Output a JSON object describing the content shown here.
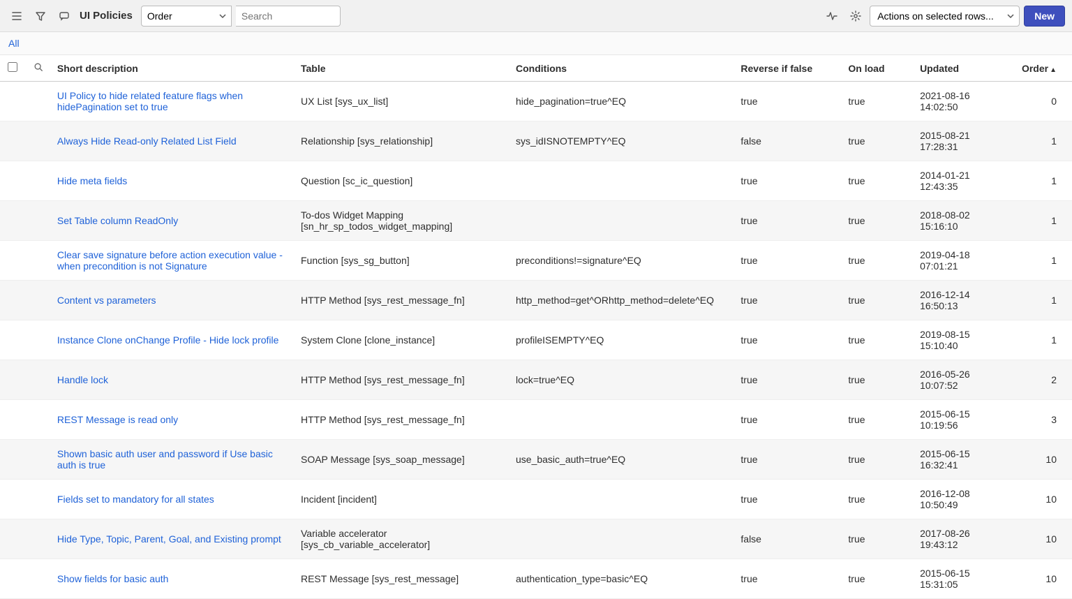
{
  "toolbar": {
    "title": "UI Policies",
    "search_field_selected": "Order",
    "search_placeholder": "Search",
    "actions_placeholder": "Actions on selected rows...",
    "new_label": "New"
  },
  "breadcrumb": {
    "all": "All"
  },
  "columns": {
    "short_description": "Short description",
    "table": "Table",
    "conditions": "Conditions",
    "reverse_if_false": "Reverse if false",
    "on_load": "On load",
    "updated": "Updated",
    "order": "Order"
  },
  "rows": [
    {
      "desc": "UI Policy to hide related feature flags when hidePagination set to true",
      "table": "UX List [sys_ux_list]",
      "cond": "hide_pagination=true^EQ",
      "rev": "true",
      "onload": "true",
      "updated": "2021-08-16 14:02:50",
      "order": "0"
    },
    {
      "desc": "Always Hide Read-only Related List Field",
      "table": "Relationship [sys_relationship]",
      "cond": "sys_idISNOTEMPTY^EQ",
      "rev": "false",
      "onload": "true",
      "updated": "2015-08-21 17:28:31",
      "order": "1"
    },
    {
      "desc": "Hide meta fields",
      "table": "Question [sc_ic_question]",
      "cond": "",
      "rev": "true",
      "onload": "true",
      "updated": "2014-01-21 12:43:35",
      "order": "1"
    },
    {
      "desc": "Set Table column ReadOnly",
      "table": "To-dos Widget Mapping [sn_hr_sp_todos_widget_mapping]",
      "cond": "",
      "rev": "true",
      "onload": "true",
      "updated": "2018-08-02 15:16:10",
      "order": "1"
    },
    {
      "desc": "Clear save signature before action execution value - when precondition is not Signature",
      "table": "Function [sys_sg_button]",
      "cond": "preconditions!=signature^EQ",
      "rev": "true",
      "onload": "true",
      "updated": "2019-04-18 07:01:21",
      "order": "1"
    },
    {
      "desc": "Content vs parameters",
      "table": "HTTP Method [sys_rest_message_fn]",
      "cond": "http_method=get^ORhttp_method=delete^EQ",
      "rev": "true",
      "onload": "true",
      "updated": "2016-12-14 16:50:13",
      "order": "1"
    },
    {
      "desc": "Instance Clone onChange Profile - Hide lock profile",
      "table": "System Clone [clone_instance]",
      "cond": "profileISEMPTY^EQ",
      "rev": "true",
      "onload": "true",
      "updated": "2019-08-15 15:10:40",
      "order": "1"
    },
    {
      "desc": "Handle lock",
      "table": "HTTP Method [sys_rest_message_fn]",
      "cond": "lock=true^EQ",
      "rev": "true",
      "onload": "true",
      "updated": "2016-05-26 10:07:52",
      "order": "2"
    },
    {
      "desc": "REST Message is read only",
      "table": "HTTP Method [sys_rest_message_fn]",
      "cond": "",
      "rev": "true",
      "onload": "true",
      "updated": "2015-06-15 10:19:56",
      "order": "3"
    },
    {
      "desc": "Shown basic auth user and password if Use basic auth is true",
      "table": "SOAP Message [sys_soap_message]",
      "cond": "use_basic_auth=true^EQ",
      "rev": "true",
      "onload": "true",
      "updated": "2015-06-15 16:32:41",
      "order": "10"
    },
    {
      "desc": "Fields set to mandatory for all states",
      "table": "Incident [incident]",
      "cond": "",
      "rev": "true",
      "onload": "true",
      "updated": "2016-12-08 10:50:49",
      "order": "10"
    },
    {
      "desc": "Hide Type, Topic, Parent, Goal, and Existing prompt",
      "table": "Variable accelerator [sys_cb_variable_accelerator]",
      "cond": "",
      "rev": "false",
      "onload": "true",
      "updated": "2017-08-26 19:43:12",
      "order": "10"
    },
    {
      "desc": "Show fields for basic auth",
      "table": "REST Message [sys_rest_message]",
      "cond": "authentication_type=basic^EQ",
      "rev": "true",
      "onload": "true",
      "updated": "2015-06-15 15:31:05",
      "order": "10"
    }
  ]
}
